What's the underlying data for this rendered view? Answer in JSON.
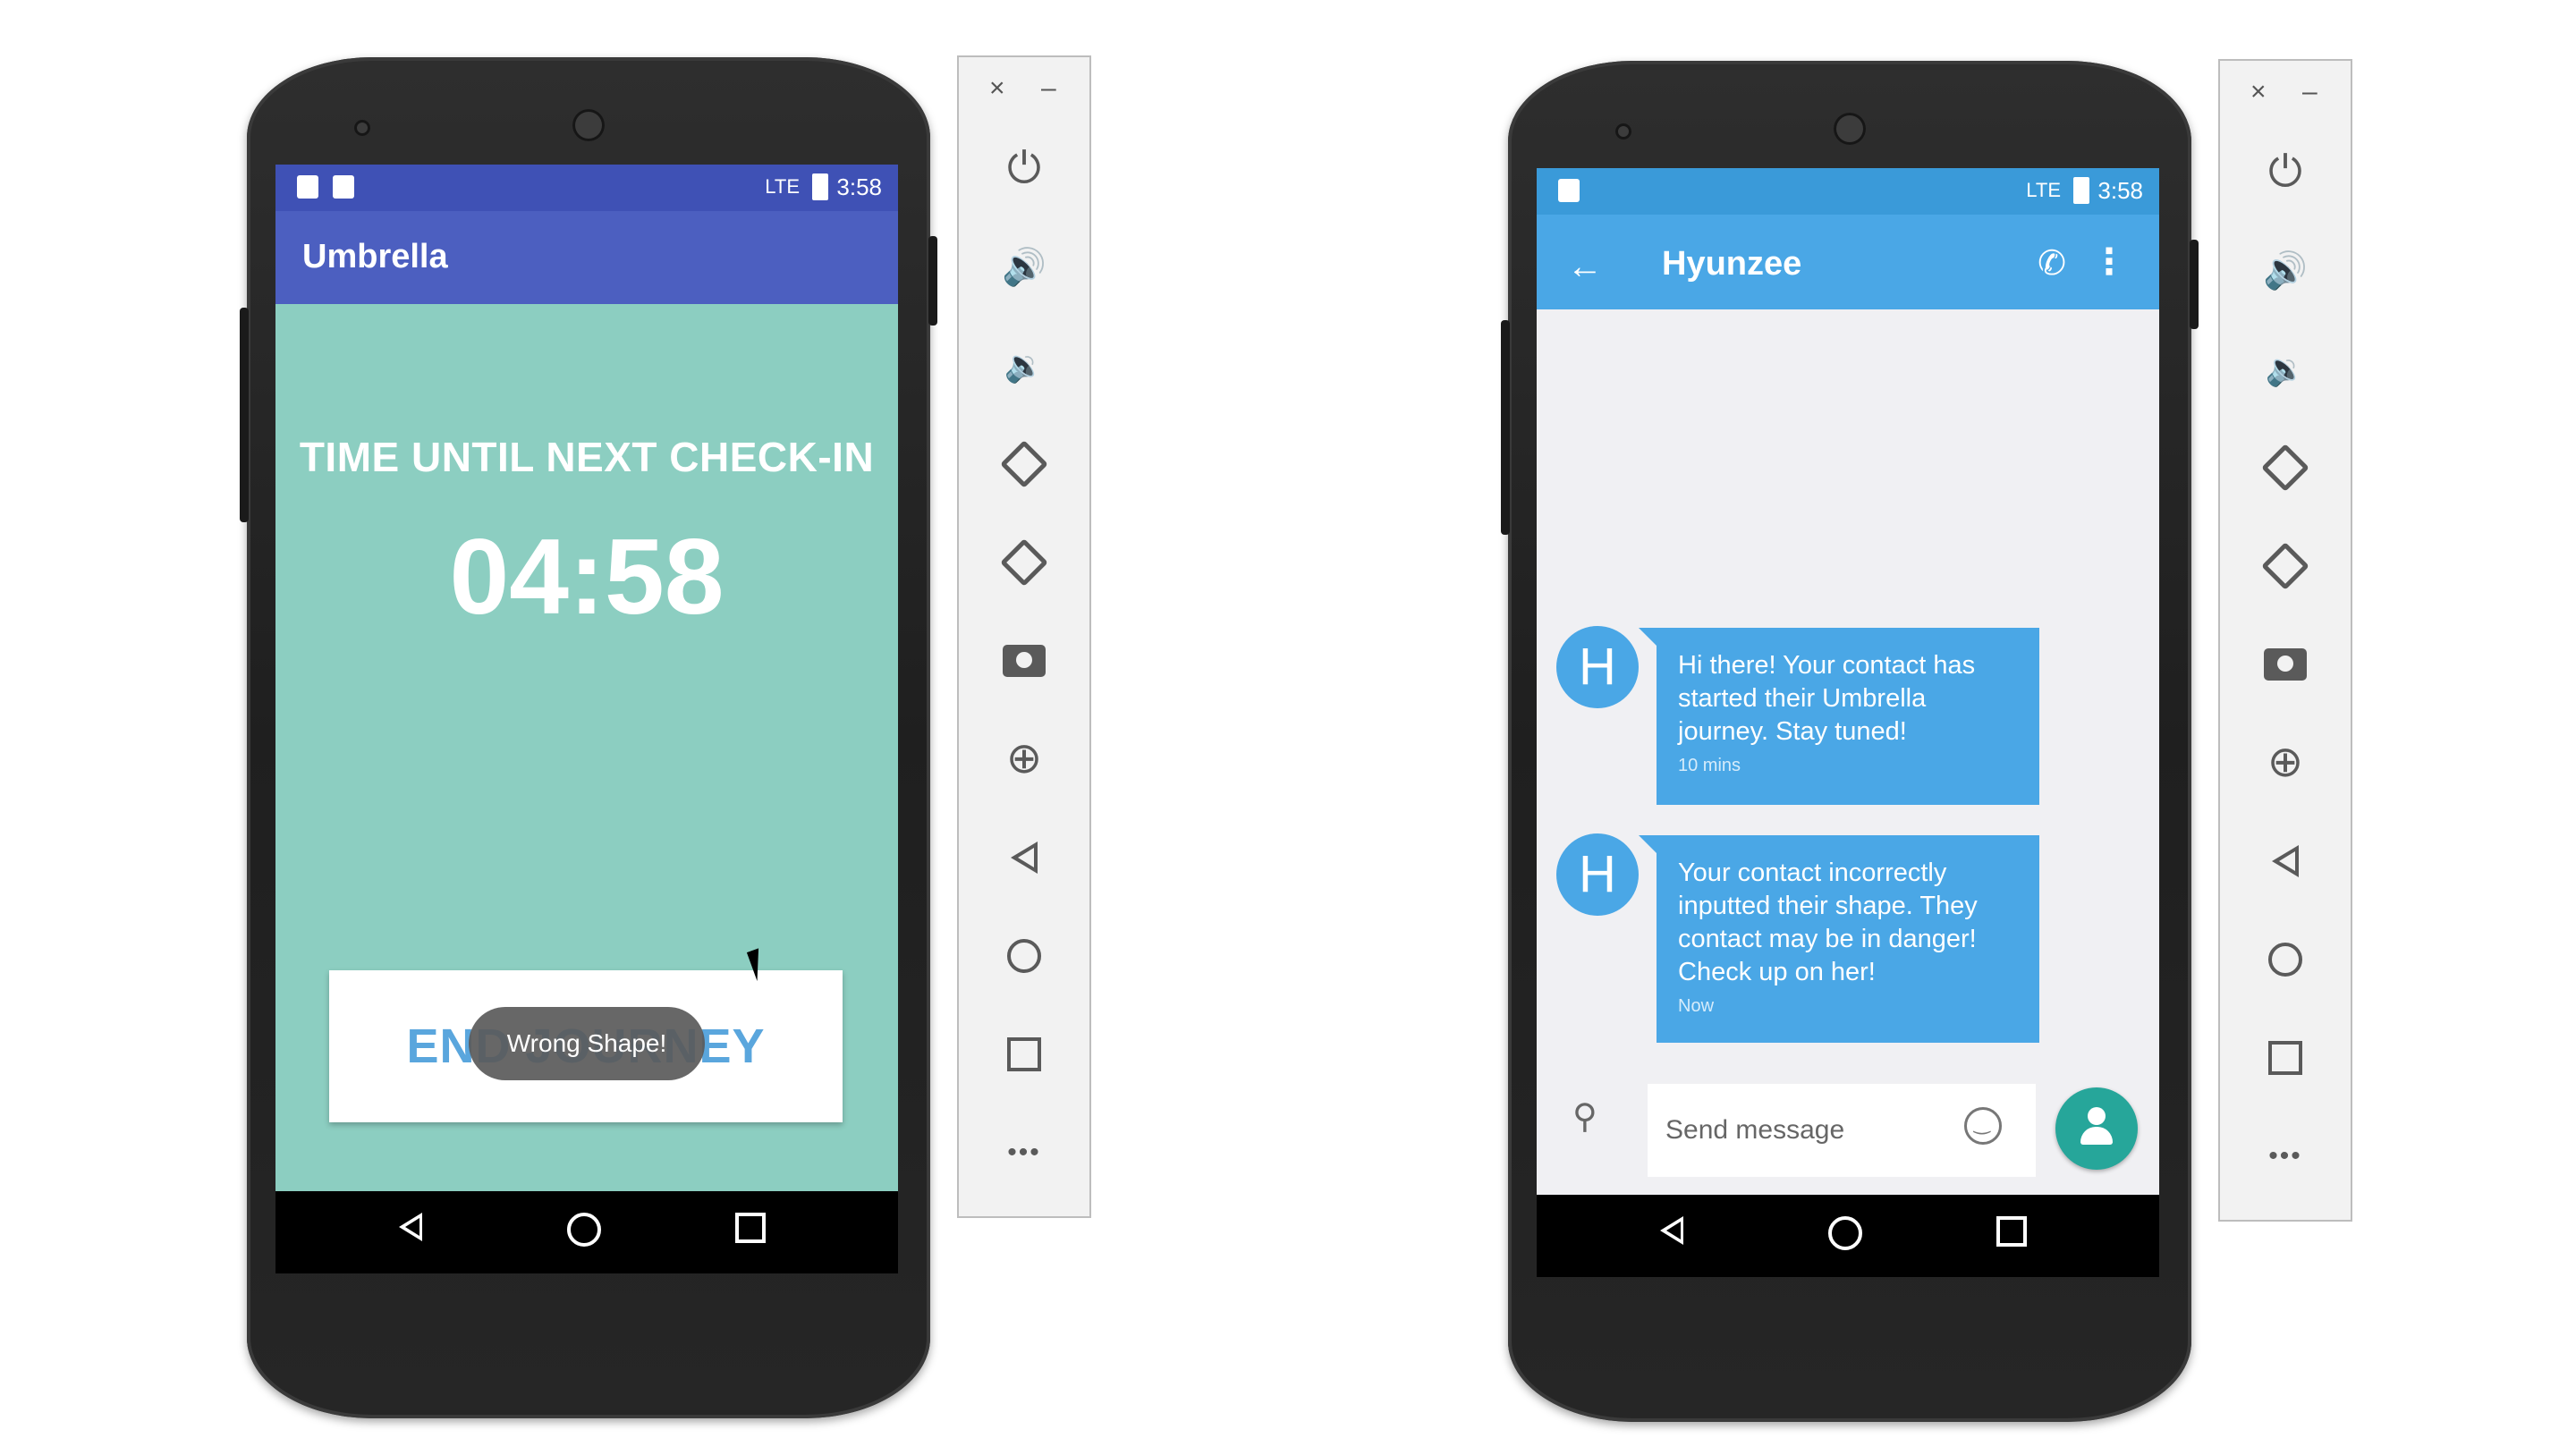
{
  "left_device": {
    "status_time": "3:58",
    "status_signal": "LTE",
    "app_title": "Umbrella",
    "checkin_label": "TIME UNTIL NEXT CHECK-IN",
    "timer": "04:58",
    "end_button_label": "END JOURNEY",
    "toast": "Wrong Shape!"
  },
  "right_device": {
    "status_time": "3:58",
    "status_signal": "LTE",
    "contact_name": "Hyunzee",
    "messages": [
      {
        "avatar": "H",
        "text": "Hi there! Your contact has started their Umbrella journey. Stay tuned!",
        "time": "10 mins"
      },
      {
        "avatar": "H",
        "text": "Your contact incorrectly inputted their shape. They contact may be in danger! Check up on her!",
        "time": "Now"
      }
    ],
    "composer_placeholder": "Send message"
  },
  "toolbar": {
    "close": "×",
    "minimize": "–",
    "tools": [
      "power-icon",
      "volume-up-icon",
      "volume-down-icon",
      "rotate-left-icon",
      "rotate-right-icon",
      "camera-icon",
      "zoom-icon",
      "back-icon",
      "home-icon",
      "overview-icon",
      "more-icon"
    ],
    "glyphs": {
      "power": "⏻",
      "volume_up": "🔊",
      "volume_down": "🔉",
      "zoom": "⊕",
      "more": "•••"
    }
  },
  "colors": {
    "umbrella_primary": "#4c5fc0",
    "umbrella_background": "#8ccec1",
    "messages_primary": "#4aa7e6",
    "fab": "#26a69a"
  }
}
